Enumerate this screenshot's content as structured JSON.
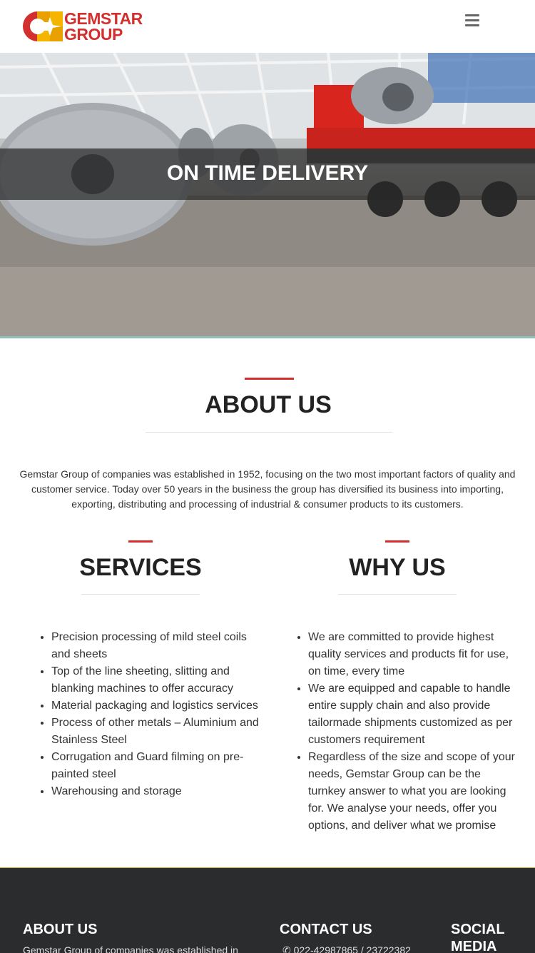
{
  "header": {
    "logo_text_1": "GEMSTAR",
    "logo_text_2": "GROUP",
    "menu_icon": "hamburger-menu-icon"
  },
  "hero": {
    "caption": "ON TIME DELIVERY"
  },
  "about": {
    "title": "ABOUT US",
    "text": "Gemstar Group of companies was established in 1952, focusing on the two most important factors of quality and customer service. Today over 50 years in the business the group has diversified its business into importing, exporting, distributing and processing of industrial & consumer products to its customers."
  },
  "services": {
    "title": "SERVICES",
    "items": [
      "Precision processing of mild steel coils and sheets",
      "Top of the line sheeting, slitting and blanking machines to offer accuracy",
      "Material packaging and logistics services",
      "Process of other metals – Aluminium and Stainless Steel",
      "Corrugation and Guard filming on pre-painted steel",
      "Warehousing and storage"
    ]
  },
  "why": {
    "title": "WHY US",
    "items": [
      "We are committed to provide highest quality services and products fit for use, on time, every time",
      "We are equipped and capable to handle entire supply chain and also provide tailormade shipments customized as per customers requirement",
      "Regardless of the size and scope of your needs, Gemstar Group can be the turnkey answer to what you are looking for. We analyse your needs, offer you options, and deliver what we promise"
    ]
  },
  "footer": {
    "about_title": "ABOUT US",
    "about_text": "Gemstar Group of companies was established in",
    "contact_title": "CONTACT US",
    "phone": "022-42987865 / 23722382",
    "social_title_1": "SOCIAL",
    "social_title_2": "MEDIA"
  },
  "colors": {
    "accent": "#d32f2f",
    "footer_bg": "#2b2c2e",
    "footer_line": "#c9a23a"
  }
}
